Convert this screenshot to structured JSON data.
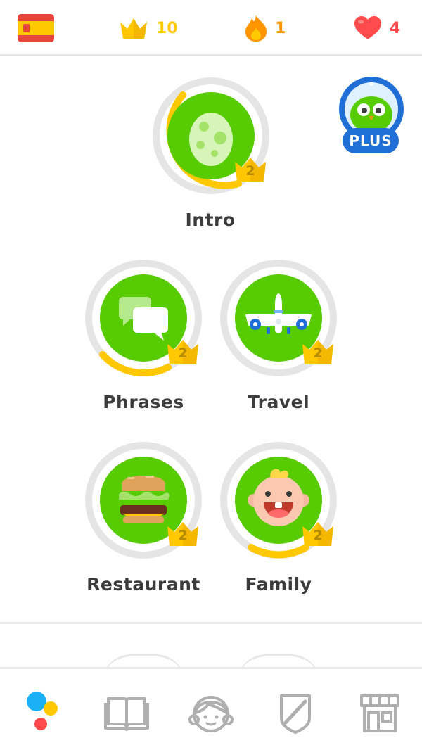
{
  "header": {
    "language_flag": "spain-flag-icon",
    "crowns": "10",
    "streak": "1",
    "hearts": "4",
    "colors": {
      "crown": "#ffc800",
      "streak": "#ff9600",
      "hearts": "#ff4b4b"
    }
  },
  "plus_badge": {
    "label": "PLUS"
  },
  "skills": [
    {
      "name": "Intro",
      "icon": "egg-icon",
      "level": "2",
      "progress": 0.4
    },
    {
      "name": "Phrases",
      "icon": "speech-bubbles-icon",
      "level": "2",
      "progress": 0.15
    },
    {
      "name": "Travel",
      "icon": "airplane-icon",
      "level": "2",
      "progress": 0
    },
    {
      "name": "Restaurant",
      "icon": "burger-icon",
      "level": "2",
      "progress": 0
    },
    {
      "name": "Family",
      "icon": "baby-icon",
      "level": "2",
      "progress": 0.15
    }
  ],
  "bottom_nav": [
    {
      "name": "learn",
      "icon": "learn-dots-icon",
      "active": true
    },
    {
      "name": "stories",
      "icon": "book-icon",
      "active": false
    },
    {
      "name": "profile",
      "icon": "profile-face-icon",
      "active": false
    },
    {
      "name": "leagues",
      "icon": "shield-icon",
      "active": false
    },
    {
      "name": "shop",
      "icon": "shop-icon",
      "active": false
    }
  ]
}
